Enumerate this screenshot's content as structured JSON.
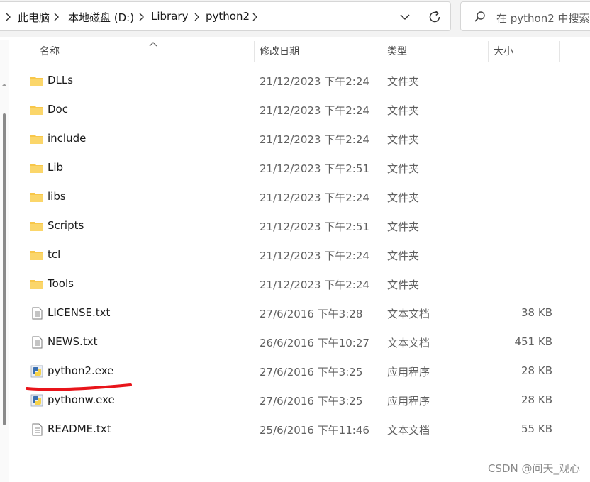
{
  "breadcrumb": [
    "此电脑",
    "本地磁盘 (D:)",
    "Library",
    "python2"
  ],
  "search": {
    "placeholder": "在 python2 中搜索"
  },
  "columns": {
    "name": "名称",
    "date": "修改日期",
    "type": "类型",
    "size": "大小"
  },
  "files": [
    {
      "name": "DLLs",
      "date": "21/12/2023 下午2:24",
      "type": "文件夹",
      "size": "",
      "icon": "folder-icon"
    },
    {
      "name": "Doc",
      "date": "21/12/2023 下午2:24",
      "type": "文件夹",
      "size": "",
      "icon": "folder-icon"
    },
    {
      "name": "include",
      "date": "21/12/2023 下午2:24",
      "type": "文件夹",
      "size": "",
      "icon": "folder-icon"
    },
    {
      "name": "Lib",
      "date": "21/12/2023 下午2:51",
      "type": "文件夹",
      "size": "",
      "icon": "folder-icon"
    },
    {
      "name": "libs",
      "date": "21/12/2023 下午2:24",
      "type": "文件夹",
      "size": "",
      "icon": "folder-icon"
    },
    {
      "name": "Scripts",
      "date": "21/12/2023 下午2:51",
      "type": "文件夹",
      "size": "",
      "icon": "folder-icon"
    },
    {
      "name": "tcl",
      "date": "21/12/2023 下午2:24",
      "type": "文件夹",
      "size": "",
      "icon": "folder-icon"
    },
    {
      "name": "Tools",
      "date": "21/12/2023 下午2:24",
      "type": "文件夹",
      "size": "",
      "icon": "folder-icon"
    },
    {
      "name": "LICENSE.txt",
      "date": "27/6/2016 下午3:28",
      "type": "文本文档",
      "size": "38 KB",
      "icon": "text-file-icon"
    },
    {
      "name": "NEWS.txt",
      "date": "26/6/2016 下午10:27",
      "type": "文本文档",
      "size": "451 KB",
      "icon": "text-file-icon"
    },
    {
      "name": "python2.exe",
      "date": "27/6/2016 下午3:25",
      "type": "应用程序",
      "size": "28 KB",
      "icon": "python-exe-icon"
    },
    {
      "name": "pythonw.exe",
      "date": "27/6/2016 下午3:25",
      "type": "应用程序",
      "size": "28 KB",
      "icon": "python-exe-icon"
    },
    {
      "name": "README.txt",
      "date": "25/6/2016 下午11:46",
      "type": "文本文档",
      "size": "55 KB",
      "icon": "text-file-icon"
    }
  ],
  "watermark": "CSDN @问天_观心",
  "colors": {
    "folder": "#f8c74a",
    "annotation": "#e8141a",
    "python_blue": "#3a6fb0",
    "python_yellow": "#f6d24b"
  }
}
